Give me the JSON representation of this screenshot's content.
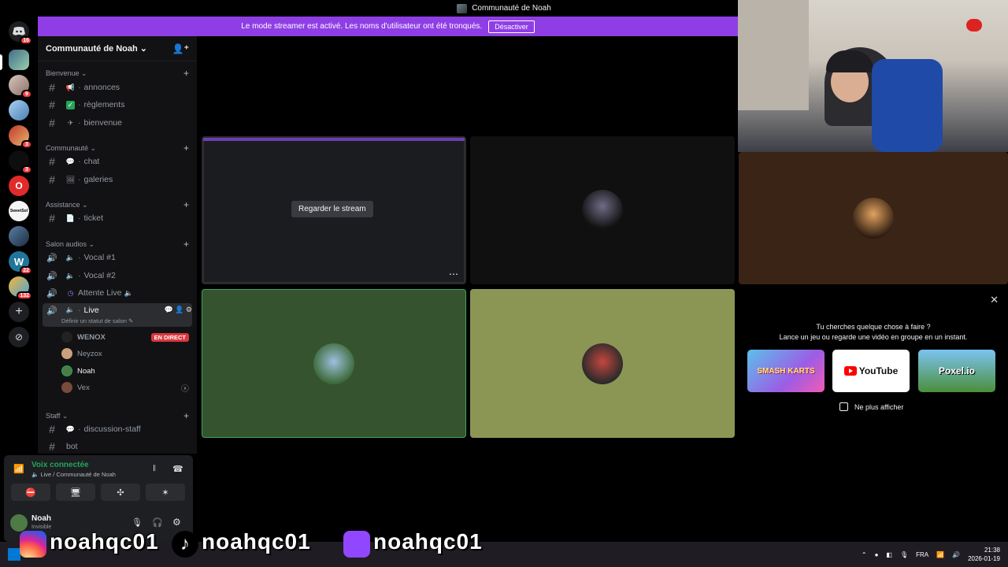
{
  "window": {
    "title": "Communauté de Noah"
  },
  "banner": {
    "text": "Le mode streamer est activé. Les noms d'utilisateur ont été tronqués.",
    "button": "Désactiver"
  },
  "servers": [
    {
      "badge": "16"
    },
    {
      "badge": ""
    },
    {
      "badge": "9"
    },
    {
      "badge": ""
    },
    {
      "badge": "3"
    },
    {
      "badge": "3"
    },
    {
      "badge": ""
    },
    {
      "badge": ""
    },
    {
      "badge": ""
    },
    {
      "badge": "22"
    },
    {
      "badge": "132"
    }
  ],
  "guild": {
    "name": "Communauté de Noah"
  },
  "categories": {
    "welcome": "Bienvenue",
    "community": "Communauté",
    "support": "Assistance",
    "voice": "Salon audios",
    "staff": "Staff"
  },
  "channels": {
    "annonces": "annonces",
    "reglements": "règlements",
    "bienvenue": "bienvenue",
    "chat": "chat",
    "galeries": "galeries",
    "ticket": "ticket",
    "vocal1": "Vocal #1",
    "vocal2": "Vocal #2",
    "attente": "Attente Live",
    "live": "Live",
    "live_status": "Définir un statut de salon",
    "discussion": "discussion-staff",
    "bot": "bot"
  },
  "members": [
    {
      "name": "WENOX",
      "live": "EN DIRECT"
    },
    {
      "name": "Neyzox",
      "live": ""
    },
    {
      "name": "Noah",
      "live": ""
    },
    {
      "name": "Vex",
      "live": ""
    }
  ],
  "voice": {
    "status": "Voix connectée",
    "path": "Live / Communauté de Noah"
  },
  "user": {
    "name": "Noah",
    "status": "Invisible"
  },
  "stage": {
    "watch_button": "Regarder le stream"
  },
  "activity": {
    "line1": "Tu cherches quelque chose à faire ?",
    "line2": "Lance un jeu ou regarde une vidéo en groupe en un instant.",
    "cards": [
      "SMASH KARTS",
      "YouTube",
      "Poxel.io"
    ],
    "dont_show": "Ne plus afficher"
  },
  "overlay": {
    "instagram": "noahqc01",
    "tiktok": "noahqc01",
    "twitch": "noahqc01"
  },
  "taskbar": {
    "lang": "FRA",
    "time": "21:38",
    "date": "2026-01-19"
  },
  "colors": {
    "accent": "#8f3ee6",
    "live": "#da373c",
    "connected": "#23a55a"
  }
}
